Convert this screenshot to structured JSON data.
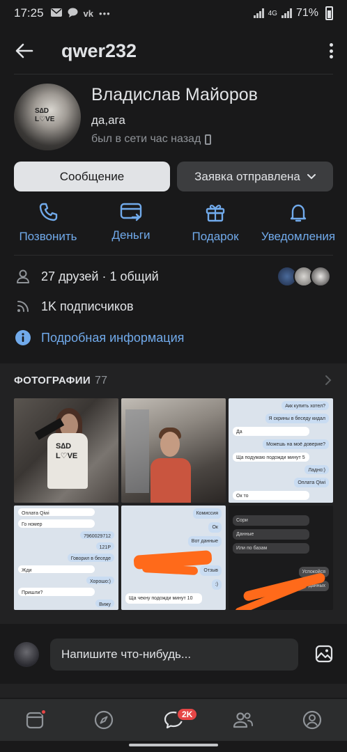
{
  "status_bar": {
    "time": "17:25",
    "network": "4G",
    "battery": "71%",
    "notif_icons": [
      "mail-icon",
      "chat-icon",
      "vk-icon",
      "more-icon"
    ]
  },
  "header": {
    "title": "qwer232"
  },
  "profile": {
    "name": "Владислав Майоров",
    "status": "да,ага",
    "last_seen": "был в сети час назад",
    "avatar_text": "SAD LOVE"
  },
  "buttons": {
    "message": "Сообщение",
    "request": "Заявка отправлена"
  },
  "actions": [
    {
      "label": "Позвонить",
      "icon": "phone-icon"
    },
    {
      "label": "Деньги",
      "icon": "money-icon"
    },
    {
      "label": "Подарок",
      "icon": "gift-icon"
    },
    {
      "label": "Уведомления",
      "icon": "bell-icon"
    }
  ],
  "info": {
    "friends": "27 друзей · 1 общий",
    "followers": "1K подписчиков",
    "details": "Подробная информация"
  },
  "photos": {
    "title": "ФОТОГРАФИИ",
    "count": "77",
    "chat3": [
      "Акк купить хотел?",
      "Я скрины в беседу кидал",
      "Да",
      "Можешь на моё доверие?",
      "Ща подумаю подожди минут 5",
      "Ладно:)",
      "Оплата Qiwi",
      "Ок то"
    ],
    "chat4": [
      "Оплата Qiwi",
      "Го номер",
      "7960029712",
      "121Р",
      "Говорил в беседе",
      "Жди",
      "Хорошо:)",
      "Пришли?",
      "Вижу"
    ],
    "chat5": [
      "Комиссия",
      "Ок",
      "Вот данные",
      "Отзыв",
      ":)",
      "Ща чекну подожди минут 10"
    ],
    "chat6": [
      "Сори",
      "Данные",
      "Или по базам",
      "Успокойся",
      "Вот данных"
    ]
  },
  "compose": {
    "placeholder": "Напишите что-нибудь..."
  },
  "tabbar": {
    "messages_badge": "2K"
  },
  "colors": {
    "accent": "#71aaeb",
    "background": "#19191a",
    "badge": "#e64646",
    "scribble": "#ff6a1a"
  }
}
